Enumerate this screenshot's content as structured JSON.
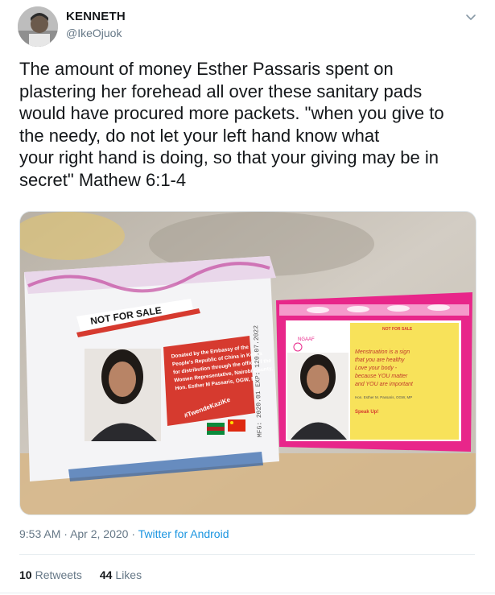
{
  "author": {
    "name": "KENNETH",
    "handle": "@IkeOjuok"
  },
  "tweet": {
    "text": "The amount of money Esther Passaris spent on\nplastering her forehead all over these  sanitary pads\nwould have procured more packets. \"when you give to\nthe needy, do not let your left hand know what\nyour right hand is doing, so that your giving may be in\nsecret\" Mathew 6:1-4",
    "time": "9:53 AM",
    "date": "Apr 2, 2020",
    "dot": "·",
    "source": "Twitter for Android"
  },
  "media": {
    "left_pack": {
      "banner": "NOT FOR SALE",
      "donation_text": [
        "Donated by the Embassy of the",
        "People's Republic of China in Kenya",
        "for distribution through the office of the",
        "Women Representative, Nairobi County,",
        "Hon. Esther M Passaris, OGW, MP"
      ],
      "hashtag": "#TwendeKaziKe",
      "side_text": "MFG: 2020.01  EXP: 120.07.2022"
    },
    "right_pack": {
      "banner": "NOT FOR SALE",
      "logo": "NGAAF",
      "message": [
        "Menstruation is a sign",
        "that you are healthy",
        "Love your body -",
        "because YOU matter",
        "and YOU are important"
      ],
      "signature": "Hon. Esther M. Passaris, OGW, MP",
      "footer": "Speak Up!"
    }
  },
  "stats": {
    "retweets_count": "10",
    "retweets_label": "Retweets",
    "likes_count": "44",
    "likes_label": "Likes"
  },
  "colors": {
    "link": "#1b95e0",
    "muted": "#657786",
    "pink": "#e8268a",
    "banner_red": "#d63a2f"
  }
}
